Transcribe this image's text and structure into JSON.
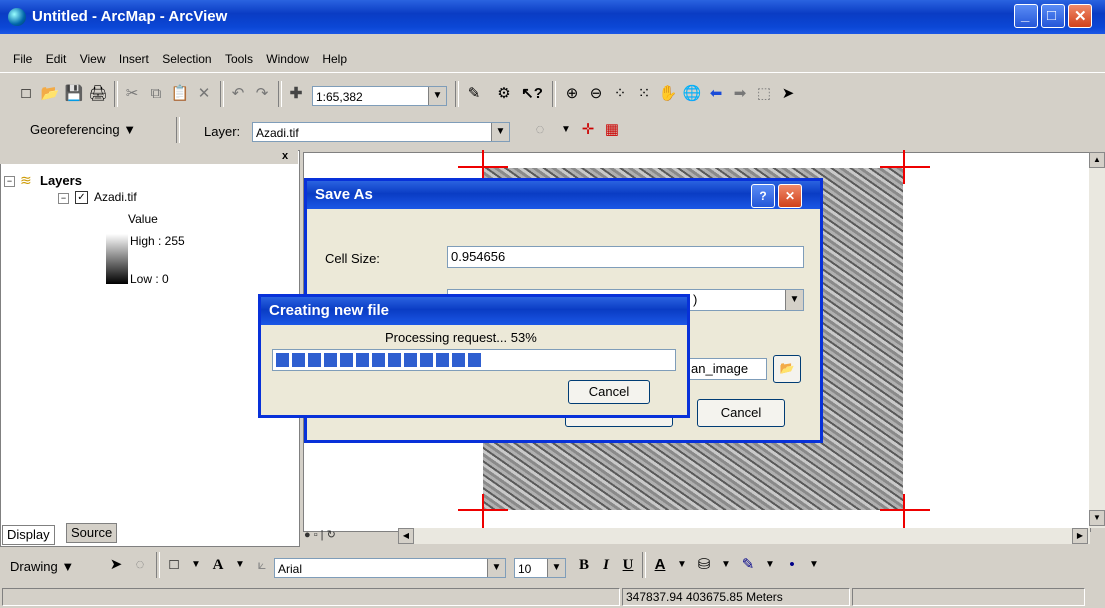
{
  "window": {
    "title": "Untitled - ArcMap - ArcView",
    "min": "_",
    "max": "□",
    "close": "✕"
  },
  "menu": [
    {
      "label": "File"
    },
    {
      "label": "Edit"
    },
    {
      "label": "View"
    },
    {
      "label": "Insert"
    },
    {
      "label": "Selection"
    },
    {
      "label": "Tools"
    },
    {
      "label": "Window"
    },
    {
      "label": "Help"
    }
  ],
  "standard_toolbar": {
    "scale_value": "1:65,382"
  },
  "georef_toolbar": {
    "menu_label": "Georeferencing",
    "layer_label": "Layer:",
    "layer_value": "Azadi.tif"
  },
  "toc": {
    "root": "Layers",
    "layer": "Azadi.tif",
    "value_label": "Value",
    "high_label": "High : 255",
    "low_label": "Low : 0",
    "tabs": [
      "Display",
      "Source"
    ]
  },
  "save_as": {
    "title": "Save As",
    "help": "?",
    "cell_size_label": "Cell Size:",
    "cell_size_value": "0.954656",
    "combo_fragment": ")",
    "name_fragment": "an_image",
    "cancel_label": "Cancel"
  },
  "progress": {
    "title": "Creating new file",
    "message": "Processing request... 53%",
    "percent": 53,
    "cancel_label": "Cancel"
  },
  "drawing_toolbar": {
    "menu_label": "Drawing",
    "font_value": "Arial",
    "size_value": "10",
    "bold": "B",
    "italic": "I",
    "underline": "U",
    "font_color": "A"
  },
  "status": {
    "coords": "347837.94  403675.85 Meters"
  },
  "colors": {
    "accent": "#0a3cc4",
    "progress": "#2f5fd0",
    "crosshair": "#e00000"
  }
}
